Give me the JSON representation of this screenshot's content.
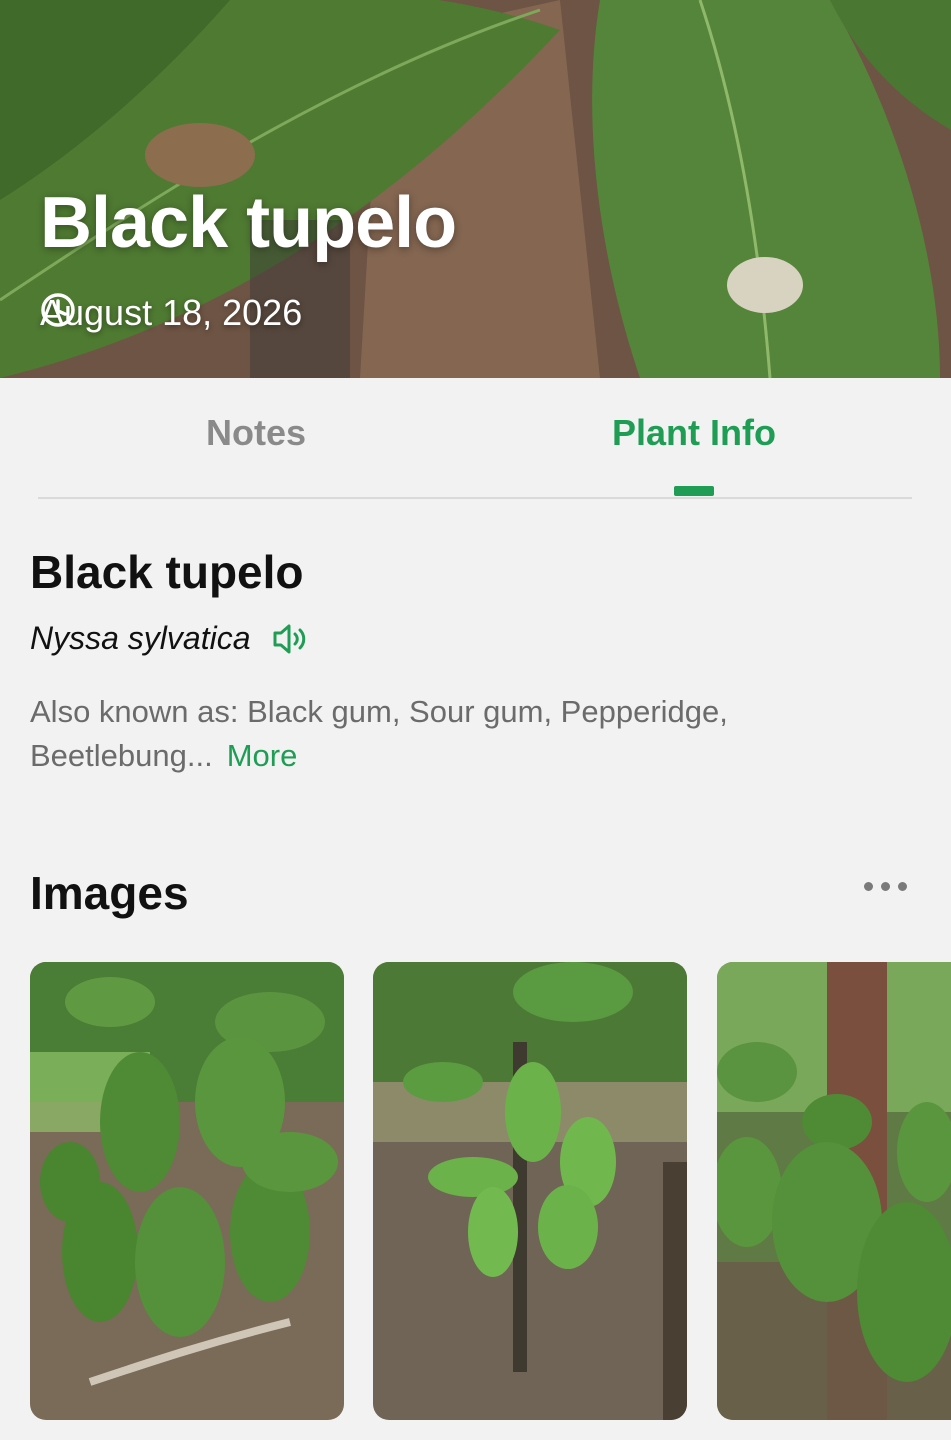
{
  "header": {
    "title": "Black tupelo",
    "date": "August 18, 2026",
    "icon": "clock-icon"
  },
  "tabs": [
    {
      "label": "Notes",
      "active": false
    },
    {
      "label": "Plant Info",
      "active": true
    }
  ],
  "plant": {
    "common_name": "Black tupelo",
    "scientific_name": "Nyssa sylvatica",
    "also_known_as": "Also known as: Black gum, Sour gum, Pepperidge, Beetlebung...",
    "more_label": "More"
  },
  "images": {
    "title": "Images",
    "menu_icon": "more-dots-icon",
    "thumbnails": [
      {
        "name": "image-thumbnail-1"
      },
      {
        "name": "image-thumbnail-2"
      },
      {
        "name": "image-thumbnail-3"
      }
    ]
  },
  "colors": {
    "accent": "#1f9d55",
    "background": "#f2f2f2",
    "inactive_tab": "#8a8a8a"
  }
}
